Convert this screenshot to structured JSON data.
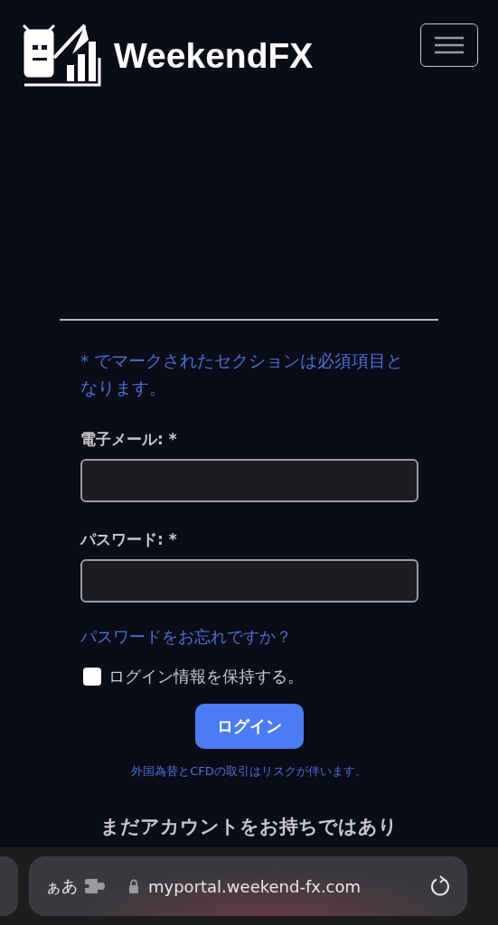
{
  "header": {
    "brand": "WeekendFX"
  },
  "form": {
    "required_note": "* でマークされたセクションは必須項目となります。",
    "fields": [
      {
        "label": "電子メール: *"
      },
      {
        "label": "パスワード: *"
      }
    ],
    "forgot_link": "パスワードをお忘れですか？",
    "remember": {
      "label": "ログイン情報を保持する。",
      "checked": false
    },
    "submit": "ログイン",
    "risk_note": "外国為替とCFDの取引はリスクが伴います。",
    "signup_heading": "まだアカウントをお持ちではあり"
  },
  "browser": {
    "text_size": "ぁあ",
    "url": "myportal.weekend-fx.com"
  }
}
